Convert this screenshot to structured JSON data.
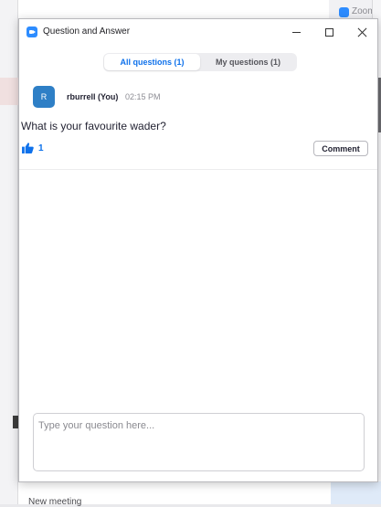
{
  "background": {
    "corner_app_label": "Zoom",
    "bottom_label": "New meeting"
  },
  "window": {
    "title": "Question and Answer"
  },
  "tabs": [
    {
      "label": "All questions (1)",
      "active": true
    },
    {
      "label": "My questions (1)",
      "active": false
    }
  ],
  "question": {
    "avatar_initial": "R",
    "author": "rburrell (You)",
    "time": "02:15 PM",
    "text": "What is your favourite wader?",
    "likes": "1",
    "comment_label": "Comment"
  },
  "input": {
    "placeholder": "Type your question here..."
  },
  "colors": {
    "accent": "#0e71eb",
    "avatar": "#2e7fc6",
    "zoom_blue": "#2d8cff"
  },
  "icons": {
    "app": "zoom-logo-icon",
    "like": "thumbs-up-icon",
    "minimize": "minimize-icon",
    "maximize": "maximize-icon",
    "close": "close-icon"
  }
}
